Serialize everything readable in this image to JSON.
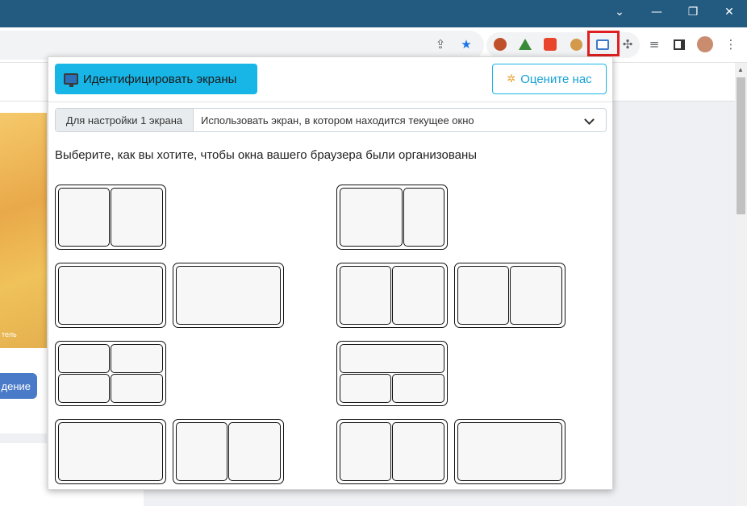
{
  "window_controls": {
    "chevron": "⌄",
    "minimize": "—",
    "restore": "❐",
    "close": "✕"
  },
  "toolbar_icons": [
    "share-icon",
    "bookmark-star-icon",
    "ext-icon-1",
    "ext-icon-2",
    "ext-icon-3",
    "cookie-icon",
    "screen-extension-icon",
    "puzzle-icon",
    "media-icon",
    "sidepanel-icon",
    "avatar",
    "menu-icon"
  ],
  "page": {
    "banner_text": "тель",
    "button_label": "дение"
  },
  "popup": {
    "identify_button": "Идентифицировать экраны",
    "rate_button": "Оцените нас",
    "select_label": "Для настройки 1 экрана",
    "select_value": "Использовать экран, в котором находится текущее окно",
    "instruction": "Выберите, как вы хотите, чтобы окна вашего браузера были организованы"
  },
  "colors": {
    "titlebar": "#235a80",
    "accent": "#17b6e7",
    "highlight": "#e02020"
  }
}
